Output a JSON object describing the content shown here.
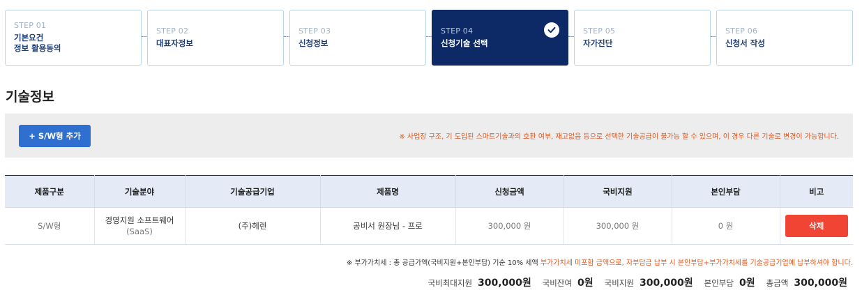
{
  "steps": [
    {
      "num": "STEP 01",
      "title_line1": "기본요건",
      "title_line2": "정보 활용동의"
    },
    {
      "num": "STEP 02",
      "title": "대표자정보"
    },
    {
      "num": "STEP 03",
      "title": "신청정보"
    },
    {
      "num": "STEP 04",
      "title": "신청기술 선택",
      "active": true
    },
    {
      "num": "STEP 05",
      "title": "자가진단"
    },
    {
      "num": "STEP 06",
      "title": "신청서 작성"
    }
  ],
  "section_title": "기술정보",
  "notice": {
    "add_button_label": "+ S/W형 추가",
    "text": "※ 사업장 구조, 기 도입된 스마트기술과의 호환 여부, 재고없음 등으로 선택한 기술공급이 불가능 할 수 있으며, 이 경우 다른 기술로 변경이 가능합니다."
  },
  "table": {
    "headers": [
      "제품구분",
      "기술분야",
      "기술공급기업",
      "제품명",
      "신청금액",
      "국비지원",
      "본인부담",
      "비고"
    ],
    "rows": [
      {
        "type": "S/W형",
        "field_line1": "경영지원 소프트웨어",
        "field_line2": "(SaaS)",
        "supplier": "(주)헤렌",
        "product": "공비서 원장님 - 프로",
        "amount": "300,000 원",
        "gov_support": "300,000 원",
        "self_pay": "0 원",
        "delete_label": "삭제"
      }
    ]
  },
  "vat_note": {
    "prefix": "※ 부가가치세 : 총 공급가액(국비지원+본인부담) 기순 10% 세액 ",
    "highlight": "부가가치세 미포함 금액으로, 자부담금 납부 시 본인부담+부가가치세를 기술공급기업에 납부하셔야 합니다."
  },
  "summary": {
    "max_support_label": "국비최대지원",
    "max_support_value": "300,000원",
    "remaining_label": "국비잔여",
    "remaining_value": "0원",
    "gov_support_label": "국비지원",
    "gov_support_value": "300,000원",
    "self_pay_label": "본인부담",
    "self_pay_value": "0원",
    "total_label": "총금액",
    "total_value": "300,000원"
  },
  "colors": {
    "active_step": "#0d2a66",
    "add_button": "#2f6fd0",
    "delete_button": "#f04535",
    "notice_text": "#e2561b"
  }
}
